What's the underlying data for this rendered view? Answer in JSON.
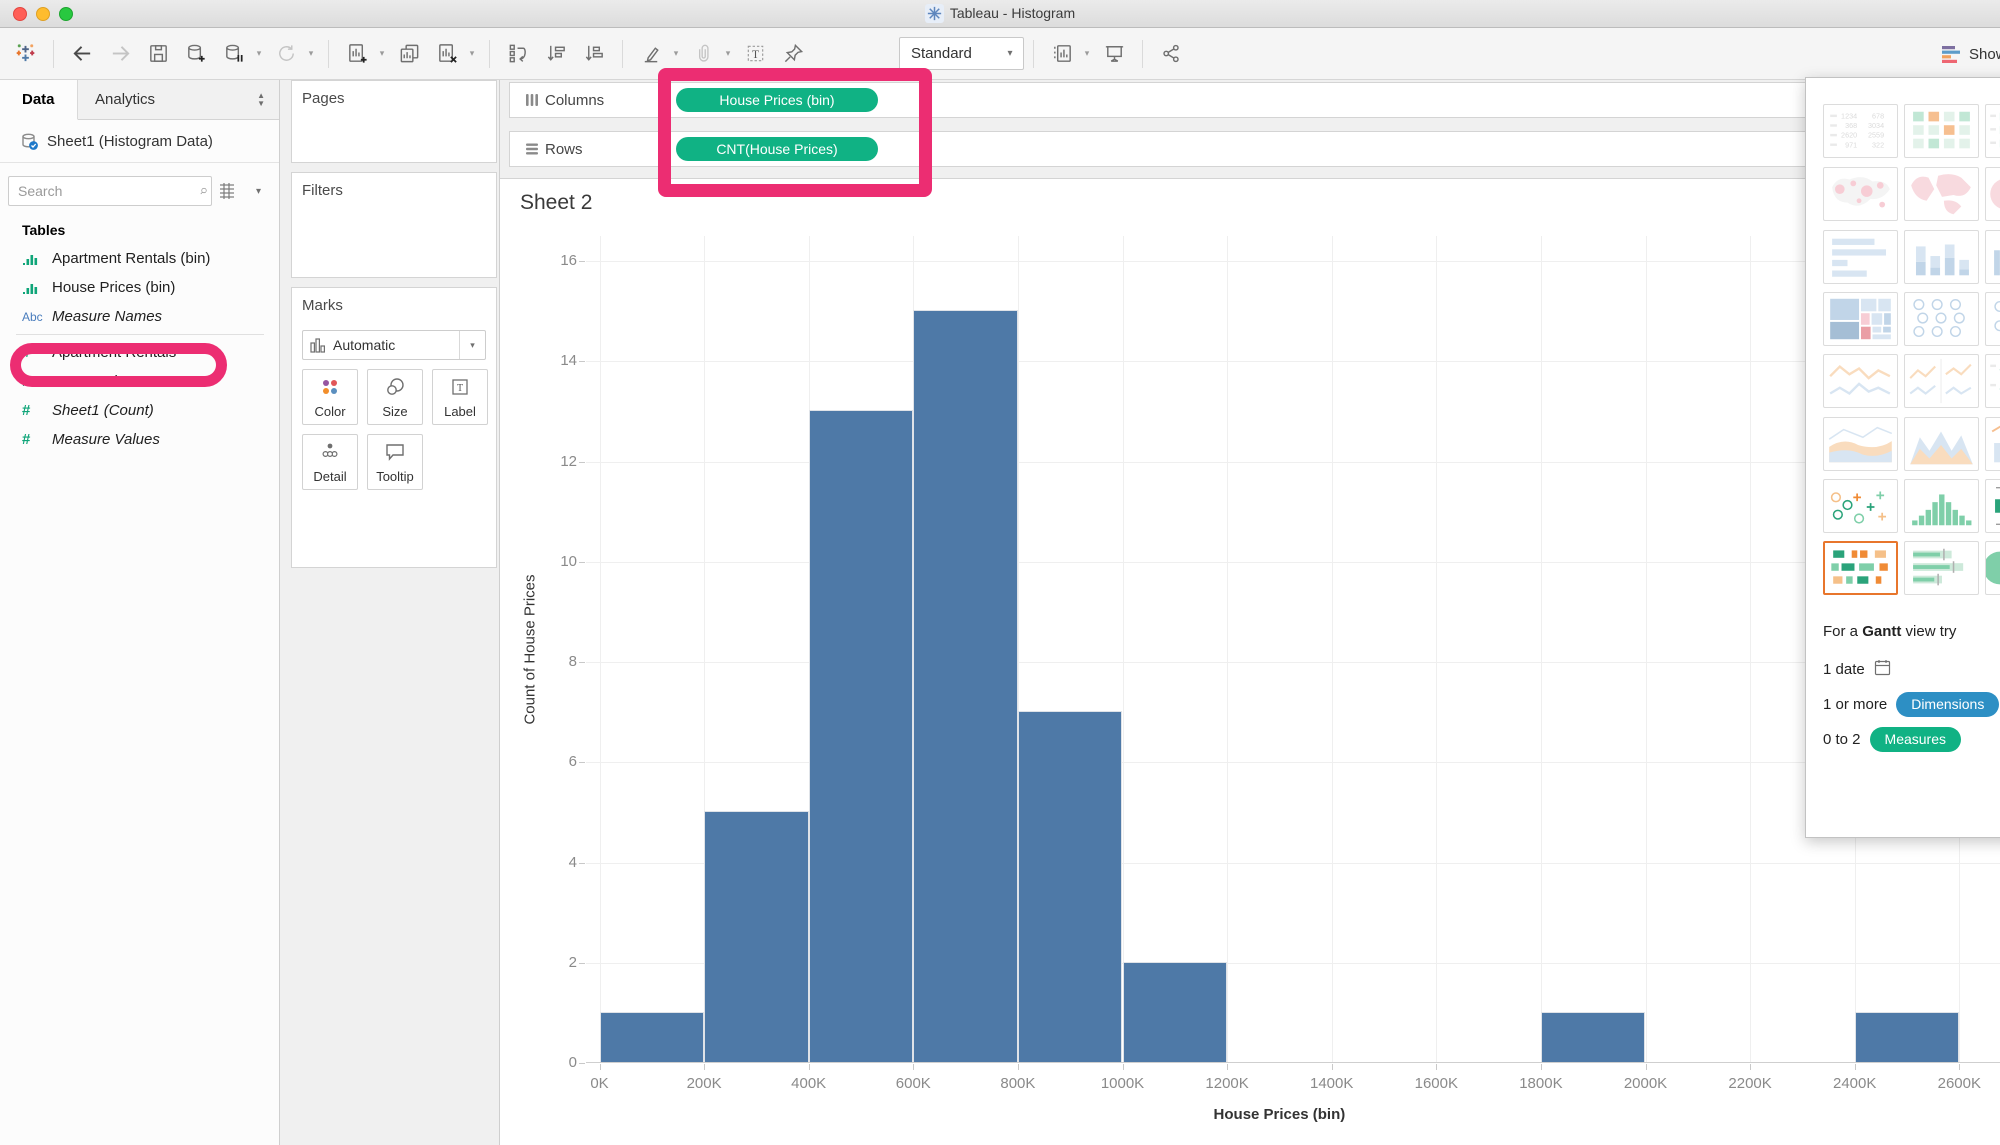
{
  "window": {
    "title": "Tableau - Histogram"
  },
  "toolbar": {
    "view_mode": "Standard",
    "show_me_label": "Show Me"
  },
  "data_pane": {
    "tabs": {
      "data": "Data",
      "analytics": "Analytics"
    },
    "datasource": "Sheet1 (Histogram Data)",
    "search_placeholder": "Search",
    "tables_label": "Tables",
    "fields": [
      {
        "label": "Apartment Rentals (bin)",
        "icon": "histogram",
        "italic": false,
        "highlight": false
      },
      {
        "label": "House Prices (bin)",
        "icon": "histogram",
        "italic": false,
        "highlight": true
      },
      {
        "label": "Measure Names",
        "icon": "abc",
        "italic": true,
        "divider_after": true
      },
      {
        "label": "Apartment Rentals",
        "icon": "number",
        "italic": false
      },
      {
        "label": "House Prices",
        "icon": "number",
        "italic": false
      },
      {
        "label": "Sheet1 (Count)",
        "icon": "number",
        "italic": true
      },
      {
        "label": "Measure Values",
        "icon": "number",
        "italic": true
      }
    ]
  },
  "cards": {
    "pages_label": "Pages",
    "filters_label": "Filters",
    "marks_label": "Marks",
    "mark_type": "Automatic",
    "mark_buttons": [
      {
        "label": "Color",
        "icon": "color"
      },
      {
        "label": "Size",
        "icon": "size"
      },
      {
        "label": "Label",
        "icon": "label"
      },
      {
        "label": "Detail",
        "icon": "detail"
      },
      {
        "label": "Tooltip",
        "icon": "tooltip"
      }
    ]
  },
  "shelves": {
    "columns_label": "Columns",
    "rows_label": "Rows",
    "columns_pills": [
      {
        "label": "House Prices (bin)"
      }
    ],
    "rows_pills": [
      {
        "label": "CNT(House Prices)"
      }
    ],
    "pill_color": "#10b284"
  },
  "sheet": {
    "title": "Sheet 2"
  },
  "chart_data": {
    "type": "bar",
    "title": "Sheet 2",
    "xlabel": "House Prices (bin)",
    "ylabel": "Count of House Prices",
    "x_tick_labels": [
      "0K",
      "200K",
      "400K",
      "600K",
      "800K",
      "1000K",
      "1200K",
      "1400K",
      "1600K",
      "1800K",
      "2000K",
      "2200K",
      "2400K",
      "2600K"
    ],
    "y_ticks": [
      0,
      2,
      4,
      6,
      8,
      10,
      12,
      14,
      16
    ],
    "ylim": [
      0,
      16.5
    ],
    "bin_width_k": 200,
    "bins": [
      {
        "start": "0K",
        "end": "200K",
        "count": 1
      },
      {
        "start": "200K",
        "end": "400K",
        "count": 5
      },
      {
        "start": "400K",
        "end": "600K",
        "count": 13
      },
      {
        "start": "600K",
        "end": "800K",
        "count": 15
      },
      {
        "start": "800K",
        "end": "1000K",
        "count": 7
      },
      {
        "start": "1000K",
        "end": "1200K",
        "count": 2
      },
      {
        "start": "1200K",
        "end": "1400K",
        "count": 0
      },
      {
        "start": "1400K",
        "end": "1600K",
        "count": 0
      },
      {
        "start": "1600K",
        "end": "1800K",
        "count": 0
      },
      {
        "start": "1800K",
        "end": "2000K",
        "count": 1
      },
      {
        "start": "2000K",
        "end": "2200K",
        "count": 0
      },
      {
        "start": "2200K",
        "end": "2400K",
        "count": 0
      },
      {
        "start": "2400K",
        "end": "2600K",
        "count": 1
      }
    ],
    "bar_color": "#4e79a7",
    "grid": true,
    "legend": "none"
  },
  "show_me": {
    "thumbnails": [
      {
        "name": "text-table",
        "state": "disabled"
      },
      {
        "name": "highlight-table",
        "state": "disabled"
      },
      {
        "name": "heat-map",
        "state": "disabled"
      },
      {
        "name": "symbol-map",
        "state": "disabled"
      },
      {
        "name": "filled-map",
        "state": "disabled"
      },
      {
        "name": "pie-chart",
        "state": "disabled"
      },
      {
        "name": "horizontal-bars",
        "state": "disabled"
      },
      {
        "name": "stacked-bars",
        "state": "disabled"
      },
      {
        "name": "side-by-side-bars",
        "state": "disabled"
      },
      {
        "name": "treemap",
        "state": "disabled"
      },
      {
        "name": "circle-views",
        "state": "disabled"
      },
      {
        "name": "side-by-side-circles",
        "state": "disabled"
      },
      {
        "name": "continuous-lines",
        "state": "disabled"
      },
      {
        "name": "dual-lines",
        "state": "disabled"
      },
      {
        "name": "table-lines",
        "state": "disabled"
      },
      {
        "name": "area-continuous",
        "state": "disabled"
      },
      {
        "name": "area-discrete",
        "state": "disabled"
      },
      {
        "name": "dual-combination",
        "state": "disabled"
      },
      {
        "name": "scatter-plot",
        "state": "enabled"
      },
      {
        "name": "histogram",
        "state": "enabled"
      },
      {
        "name": "box-plot",
        "state": "enabled"
      },
      {
        "name": "gantt",
        "state": "selected"
      },
      {
        "name": "bullet-graph",
        "state": "enabled"
      },
      {
        "name": "packed-bubbles",
        "state": "enabled"
      }
    ],
    "table_numbers": [
      [
        "1234",
        "678"
      ],
      [
        "368",
        "3034"
      ],
      [
        "2620",
        "2559"
      ],
      [
        "971",
        "322"
      ]
    ],
    "hint_prefix": "For a",
    "hint_bold": "Gantt",
    "hint_suffix": "view try",
    "requirements": [
      {
        "text": "1 date",
        "icon": "calendar-icon"
      },
      {
        "text": "1 or more",
        "pill": "Dimensions",
        "pill_color": "#2d8fc4"
      },
      {
        "text": "0 to 2",
        "pill": "Measures",
        "pill_color": "#10b284"
      }
    ]
  },
  "annotations": {
    "highlight_color": "#ec2d72"
  }
}
